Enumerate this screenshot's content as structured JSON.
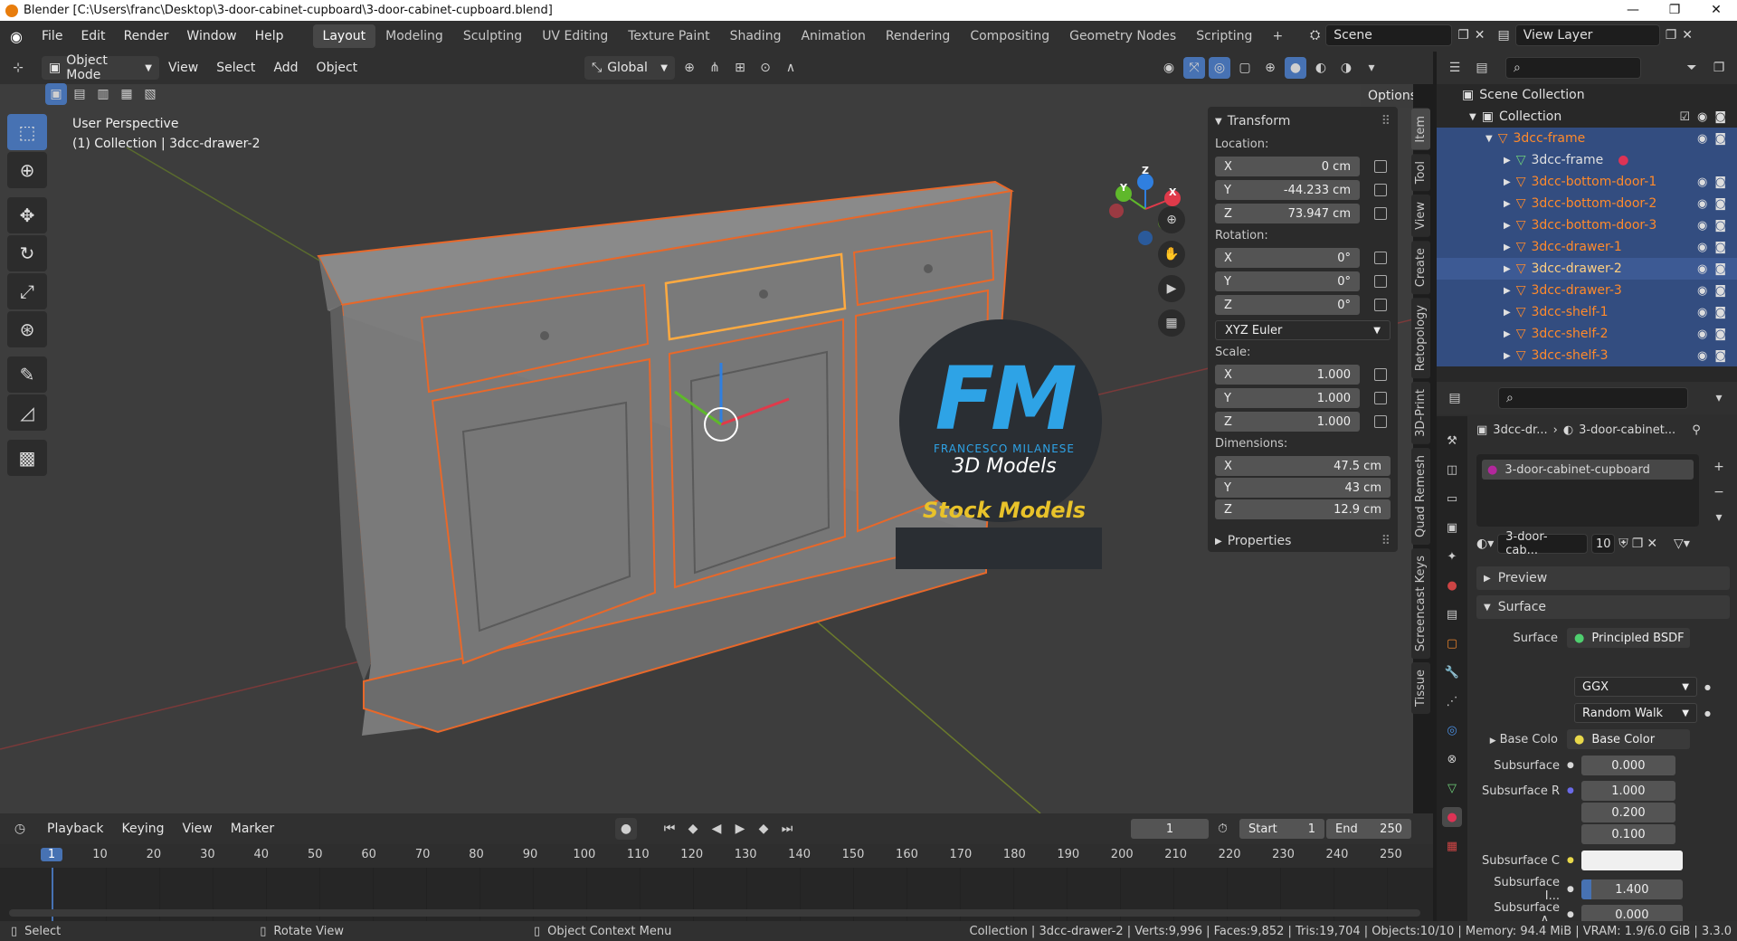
{
  "titlebar": {
    "text": "Blender [C:\\Users\\franc\\Desktop\\3-door-cabinet-cupboard\\3-door-cabinet-cupboard.blend]",
    "min": "—",
    "max": "❐",
    "close": "✕"
  },
  "menu": [
    "File",
    "Edit",
    "Render",
    "Window",
    "Help"
  ],
  "workspaces": [
    "Layout",
    "Modeling",
    "Sculpting",
    "UV Editing",
    "Texture Paint",
    "Shading",
    "Animation",
    "Rendering",
    "Compositing",
    "Geometry Nodes",
    "Scripting"
  ],
  "workspace_add": "+",
  "scene": "Scene",
  "view_layer": "View Layer",
  "vp_header": {
    "mode": "Object Mode",
    "menus": [
      "View",
      "Select",
      "Add",
      "Object"
    ],
    "orientation": "Global",
    "options": "Options"
  },
  "viewport": {
    "perspective": "User Perspective",
    "collection_info": "(1) Collection | 3dcc-drawer-2"
  },
  "gizmo": {
    "x": "X",
    "y": "Y",
    "z": "Z"
  },
  "watermark": {
    "fm": "FM",
    "author": "FRANCESCO MILANESE",
    "models": "3D Models",
    "stock": "Stock Models"
  },
  "npanel": {
    "transform": "Transform",
    "location_label": "Location:",
    "location": [
      {
        "axis": "X",
        "value": "0 cm"
      },
      {
        "axis": "Y",
        "value": "-44.233 cm"
      },
      {
        "axis": "Z",
        "value": "73.947 cm"
      }
    ],
    "rotation_label": "Rotation:",
    "rotation": [
      {
        "axis": "X",
        "value": "0°"
      },
      {
        "axis": "Y",
        "value": "0°"
      },
      {
        "axis": "Z",
        "value": "0°"
      }
    ],
    "rotation_mode": "XYZ Euler",
    "scale_label": "Scale:",
    "scale": [
      {
        "axis": "X",
        "value": "1.000"
      },
      {
        "axis": "Y",
        "value": "1.000"
      },
      {
        "axis": "Z",
        "value": "1.000"
      }
    ],
    "dimensions_label": "Dimensions:",
    "dimensions": [
      {
        "axis": "X",
        "value": "47.5 cm"
      },
      {
        "axis": "Y",
        "value": "43 cm"
      },
      {
        "axis": "Z",
        "value": "12.9 cm"
      }
    ],
    "properties": "Properties"
  },
  "vtabs": [
    "Item",
    "Tool",
    "View",
    "Create",
    "Retopology",
    "3D-Print",
    "Quad Remesh",
    "Screencast Keys",
    "Tissue"
  ],
  "outliner": {
    "scene_collection": "Scene Collection",
    "collection": "Collection",
    "items": [
      {
        "name": "3dcc-frame",
        "selected": true,
        "level": 2
      },
      {
        "name": "3dcc-frame",
        "selected": true,
        "level": 3,
        "mesh": true
      },
      {
        "name": "3dcc-bottom-door-1",
        "selected": true,
        "level": 3
      },
      {
        "name": "3dcc-bottom-door-2",
        "selected": true,
        "level": 3
      },
      {
        "name": "3dcc-bottom-door-3",
        "selected": true,
        "level": 3
      },
      {
        "name": "3dcc-drawer-1",
        "selected": true,
        "level": 3
      },
      {
        "name": "3dcc-drawer-2",
        "selected": true,
        "level": 3,
        "active": true
      },
      {
        "name": "3dcc-drawer-3",
        "selected": true,
        "level": 3
      },
      {
        "name": "3dcc-shelf-1",
        "selected": true,
        "level": 3
      },
      {
        "name": "3dcc-shelf-2",
        "selected": true,
        "level": 3
      },
      {
        "name": "3dcc-shelf-3",
        "selected": true,
        "level": 3
      }
    ]
  },
  "props": {
    "breadcrumb_obj": "3dcc-dr...",
    "breadcrumb_mat": "3-door-cabinet...",
    "material_slot": "3-door-cabinet-cupboard",
    "material_name": "3-door-cab...",
    "users": "10",
    "preview": "Preview",
    "surface_section": "Surface",
    "surface_label": "Surface",
    "surface_value": "Principled BSDF",
    "distribution": "GGX",
    "subsurface_method": "Random Walk",
    "base_color_label": "Base Colo",
    "base_color_value": "Base Color",
    "subsurface_label": "Subsurface",
    "subsurface_value": "0.000",
    "subsurface_r_label": "Subsurface R",
    "subsurface_r": [
      "1.000",
      "0.200",
      "0.100"
    ],
    "subsurface_c_label": "Subsurface C",
    "subsurface_ior_label": "Subsurface I...",
    "subsurface_ior": "1.400",
    "subsurface_a_label": "Subsurface A...",
    "subsurface_a": "0.000"
  },
  "timeline": {
    "menus": [
      "Playback",
      "Keying",
      "View",
      "Marker"
    ],
    "current_frame": "1",
    "start_label": "Start",
    "start": "1",
    "end_label": "End",
    "end": "250",
    "ticks": [
      "1",
      "10",
      "20",
      "30",
      "40",
      "50",
      "60",
      "70",
      "80",
      "90",
      "100",
      "110",
      "120",
      "130",
      "140",
      "150",
      "160",
      "170",
      "180",
      "190",
      "200",
      "210",
      "220",
      "230",
      "240",
      "250"
    ]
  },
  "status": {
    "select": "Select",
    "rotate": "Rotate View",
    "context": "Object Context Menu",
    "stats": "Collection | 3dcc-drawer-2 | Verts:9,996 | Faces:9,852 | Tris:19,704 | Objects:10/10 | Memory: 94.4 MiB | VRAM: 1.9/6.0 GiB | 3.3.0"
  },
  "colors": {
    "accent": "#4772b3",
    "selection": "#ff8a2b",
    "active": "#ffaa40",
    "viewport": "#3d3d3d"
  }
}
